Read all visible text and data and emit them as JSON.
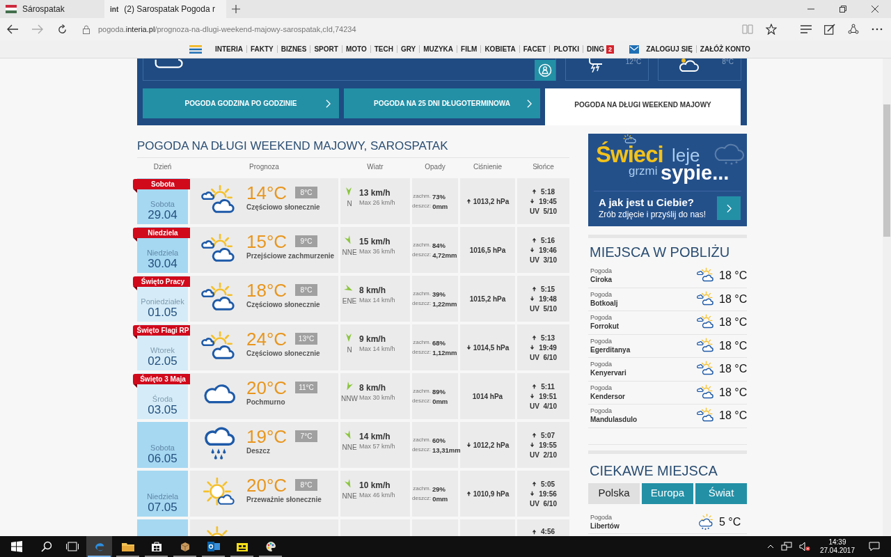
{
  "browser": {
    "tabs": [
      {
        "title": "Sárospatak",
        "kind": "flag",
        "selected": false
      },
      {
        "title": "(2) Sarospatak Pogoda r",
        "kind": "site",
        "favicon_text": "int",
        "selected": true
      }
    ],
    "address": "pogoda.**interia.pl**/prognoza-na-dlugi-weekend-majowy-sarospatak,cId,74234"
  },
  "site_nav": {
    "items": [
      {
        "label": "INTERIA"
      },
      {
        "label": "FAKTY"
      },
      {
        "label": "BIZNES"
      },
      {
        "label": "SPORT"
      },
      {
        "label": "MOTO"
      },
      {
        "label": "TECH"
      },
      {
        "label": "GRY"
      },
      {
        "label": "MUZYKA"
      },
      {
        "label": "FILM"
      },
      {
        "label": "KOBIETA"
      },
      {
        "label": "FACET"
      },
      {
        "label": "PLOTKI"
      },
      {
        "label": "DING",
        "badge": "2"
      }
    ],
    "login": "ZALOGUJ SIĘ",
    "register": "ZAŁÓŻ KONTO"
  },
  "header": {
    "cards": [
      {
        "kind": "storm",
        "temp": "12°C"
      },
      {
        "kind": "night_cloud",
        "temp": "8°C"
      }
    ],
    "tabs": [
      {
        "label": "POGODA GODZINA PO GODZINIE",
        "selected": false
      },
      {
        "label": "POGODA NA 25 DNI DŁUGOTERMINOWA",
        "selected": false
      },
      {
        "label": "POGODA NA DŁUGI WEEKEND MAJOWY",
        "selected": true
      }
    ]
  },
  "forecast": {
    "title": "POGODA NA DŁUGI WEEKEND MAJOWY, SAROSPATAK",
    "columns": [
      "Dzień",
      "Prognoza",
      "Wiatr",
      "Opady",
      "Ciśnienie",
      "Słońce"
    ],
    "rows": [
      {
        "day": {
          "kind": "weekend",
          "ribbon": "Sobota",
          "name": "Sobota",
          "date": "29.04"
        },
        "weather": {
          "kind": "partly",
          "temp": "14°C",
          "min_temp": "8°C",
          "description": "Częściowo słonecznie"
        },
        "wind": {
          "kind": "n",
          "direction": "N",
          "speed": "13 km/h",
          "max": "Max 26 km/h"
        },
        "precip": [
          {
            "label": "zachm.",
            "value": "73%"
          },
          {
            "label": "deszcz:",
            "value": "0mm"
          }
        ],
        "pressure": {
          "kind": "up",
          "value": "1013,2 hPa"
        },
        "sunrise": "5:18",
        "sunset": "19:45",
        "uv": "UV  5/10"
      },
      {
        "day": {
          "kind": "weekend",
          "ribbon": "Niedziela",
          "name": "Niedziela",
          "date": "30.04"
        },
        "weather": {
          "kind": "partly",
          "temp": "15°C",
          "min_temp": "9°C",
          "description": "Przejściowe zachmurzenie"
        },
        "wind": {
          "kind": "nne",
          "direction": "NNE",
          "speed": "15 km/h",
          "max": "Max 36 km/h"
        },
        "precip": [
          {
            "label": "zachm.",
            "value": "84%"
          },
          {
            "label": "deszcz:",
            "value": "4,72mm"
          }
        ],
        "pressure": {
          "kind": "none",
          "value": "1016,5 hPa"
        },
        "sunrise": "5:16",
        "sunset": "19:46",
        "uv": "UV  3/10"
      },
      {
        "day": {
          "kind": "weekday",
          "ribbon": "Święto Pracy",
          "name": "Poniedziałek",
          "date": "01.05"
        },
        "weather": {
          "kind": "partly",
          "temp": "18°C",
          "min_temp": "8°C",
          "description": "Częściowo słonecznie"
        },
        "wind": {
          "kind": "ene",
          "direction": "ENE",
          "speed": "8 km/h",
          "max": "Max 14 km/h"
        },
        "precip": [
          {
            "label": "zachm.",
            "value": "39%"
          },
          {
            "label": "deszcz:",
            "value": "1,22mm"
          }
        ],
        "pressure": {
          "kind": "none",
          "value": "1015,2 hPa"
        },
        "sunrise": "5:15",
        "sunset": "19:48",
        "uv": "UV  5/10"
      },
      {
        "day": {
          "kind": "weekday",
          "ribbon": "Święto Flagi RP",
          "name": "Wtorek",
          "date": "02.05"
        },
        "weather": {
          "kind": "partly",
          "temp": "24°C",
          "min_temp": "13°C",
          "description": "Częściowo słonecznie"
        },
        "wind": {
          "kind": "n",
          "direction": "N",
          "speed": "9 km/h",
          "max": "Max 14 km/h"
        },
        "precip": [
          {
            "label": "zachm.",
            "value": "68%"
          },
          {
            "label": "deszcz:",
            "value": "1,12mm"
          }
        ],
        "pressure": {
          "kind": "down",
          "value": "1014,5 hPa"
        },
        "sunrise": "5:13",
        "sunset": "19:49",
        "uv": "UV  6/10"
      },
      {
        "day": {
          "kind": "weekday",
          "ribbon": "Święto 3 Maja",
          "name": "Środa",
          "date": "03.05"
        },
        "weather": {
          "kind": "cloudy",
          "temp": "20°C",
          "min_temp": "11°C",
          "description": "Pochmurno"
        },
        "wind": {
          "kind": "nnw",
          "direction": "NNW",
          "speed": "8 km/h",
          "max": "Max 30 km/h"
        },
        "precip": [
          {
            "label": "zachm.",
            "value": "89%"
          },
          {
            "label": "deszcz:",
            "value": "0mm"
          }
        ],
        "pressure": {
          "kind": "none",
          "value": "1014 hPa"
        },
        "sunrise": "5:11",
        "sunset": "19:51",
        "uv": "UV  4/10"
      },
      {
        "day": {
          "kind": "weekend",
          "name": "Sobota",
          "date": "06.05"
        },
        "weather": {
          "kind": "rain",
          "temp": "19°C",
          "min_temp": "7°C",
          "description": "Deszcz"
        },
        "wind": {
          "kind": "nne",
          "direction": "NNE",
          "speed": "14 km/h",
          "max": "Max 57 km/h"
        },
        "precip": [
          {
            "label": "zachm.",
            "value": "60%"
          },
          {
            "label": "deszcz:",
            "value": "13,31mm"
          }
        ],
        "pressure": {
          "kind": "down",
          "value": "1012,2 hPa"
        },
        "sunrise": "5:07",
        "sunset": "19:55",
        "uv": "UV  2/10"
      },
      {
        "day": {
          "kind": "weekend",
          "name": "Niedziela",
          "date": "07.05"
        },
        "weather": {
          "kind": "mostly_sunny",
          "temp": "20°C",
          "min_temp": "8°C",
          "description": "Przeważnie słonecznie"
        },
        "wind": {
          "kind": "nne",
          "direction": "NNE",
          "speed": "10 km/h",
          "max": "Max 46 km/h"
        },
        "precip": [
          {
            "label": "zachm.",
            "value": "29%"
          },
          {
            "label": "deszcz:",
            "value": "0mm"
          }
        ],
        "pressure": {
          "kind": "up",
          "value": "1010,9 hPa"
        },
        "sunrise": "5:05",
        "sunset": "19:56",
        "uv": "UV  6/10"
      },
      {
        "day": {
          "kind": "weekend"
        },
        "weather": {
          "kind": "mostly_sunny"
        },
        "sunrise": "4:56"
      }
    ]
  },
  "sidebar": {
    "banner": {
      "words": [
        {
          "text": "Świeci",
          "kind": "big_yellow"
        },
        {
          "text": "leje",
          "kind": "light"
        },
        {
          "text": "grzmi",
          "kind": "small_light"
        },
        {
          "text": "sypie...",
          "kind": "big_white"
        }
      ],
      "question": "A jak jest u Ciebie?",
      "subtitle": "Zrób zdjęcie i przyślij do nas!"
    },
    "nearby": {
      "title": "MIEJSCA W POBLIŻU",
      "places": [
        {
          "label": "Pogoda",
          "name": "Ciroka",
          "kind": "partly",
          "temp": "18 °C"
        },
        {
          "label": "Pogoda",
          "name": "Botkoalj",
          "kind": "partly",
          "temp": "18 °C"
        },
        {
          "label": "Pogoda",
          "name": "Forrokut",
          "kind": "partly",
          "temp": "18 °C"
        },
        {
          "label": "Pogoda",
          "name": "Egerditanya",
          "kind": "partly",
          "temp": "18 °C"
        },
        {
          "label": "Pogoda",
          "name": "Kenyervari",
          "kind": "partly",
          "temp": "18 °C"
        },
        {
          "label": "Pogoda",
          "name": "Kendersor",
          "kind": "partly",
          "temp": "18 °C"
        },
        {
          "label": "Pogoda",
          "name": "Mandulasdulo",
          "kind": "partly",
          "temp": "18 °C"
        }
      ]
    },
    "interesting": {
      "title": "CIEKAWE MIEJSCA",
      "tabs": [
        {
          "label": "Polska",
          "selected": true
        },
        {
          "label": "Europa",
          "selected": false
        },
        {
          "label": "Świat",
          "selected": false
        }
      ],
      "places": [
        {
          "label": "Pogoda",
          "name": "Libertów",
          "kind": "rain_sun",
          "temp": "5 °C"
        }
      ]
    }
  },
  "taskbar": {
    "apps": [
      {
        "kind": "edge",
        "active": true
      },
      {
        "kind": "folder",
        "active": false
      },
      {
        "kind": "store",
        "active": false
      },
      {
        "kind": "box",
        "active": false
      },
      {
        "kind": "outlook",
        "active": false
      },
      {
        "kind": "app",
        "active": false
      },
      {
        "kind": "paint",
        "active": false
      }
    ],
    "time": "14:39",
    "date": "27.04.2017"
  }
}
